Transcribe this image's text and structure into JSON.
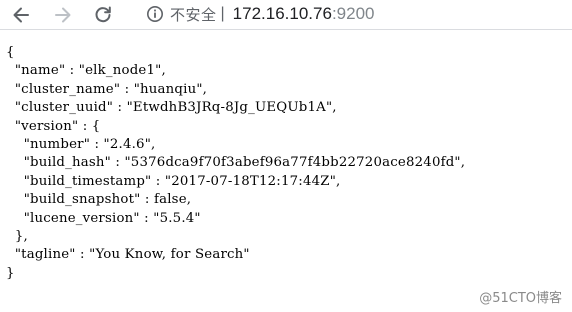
{
  "browser": {
    "back_icon": "arrow-left-icon",
    "forward_icon": "arrow-right-icon",
    "reload_icon": "reload-icon",
    "info_icon": "info-circle-icon",
    "security_label": "不安全",
    "separator": "|",
    "url_host": "172.16.10.76",
    "url_port": ":9200"
  },
  "response": {
    "lines": [
      "{",
      "  \"name\" : \"elk_node1\",",
      "  \"cluster_name\" : \"huanqiu\",",
      "  \"cluster_uuid\" : \"EtwdhB3JRq-8Jg_UEQUb1A\",",
      "  \"version\" : {",
      "    \"number\" : \"2.4.6\",",
      "    \"build_hash\" : \"5376dca9f70f3abef96a77f4bb22720ace8240fd\",",
      "    \"build_timestamp\" : \"2017-07-18T12:17:44Z\",",
      "    \"build_snapshot\" : false,",
      "    \"lucene_version\" : \"5.5.4\"",
      "  },",
      "  \"tagline\" : \"You Know, for Search\"",
      "}"
    ]
  },
  "watermark": "@51CTO博客"
}
